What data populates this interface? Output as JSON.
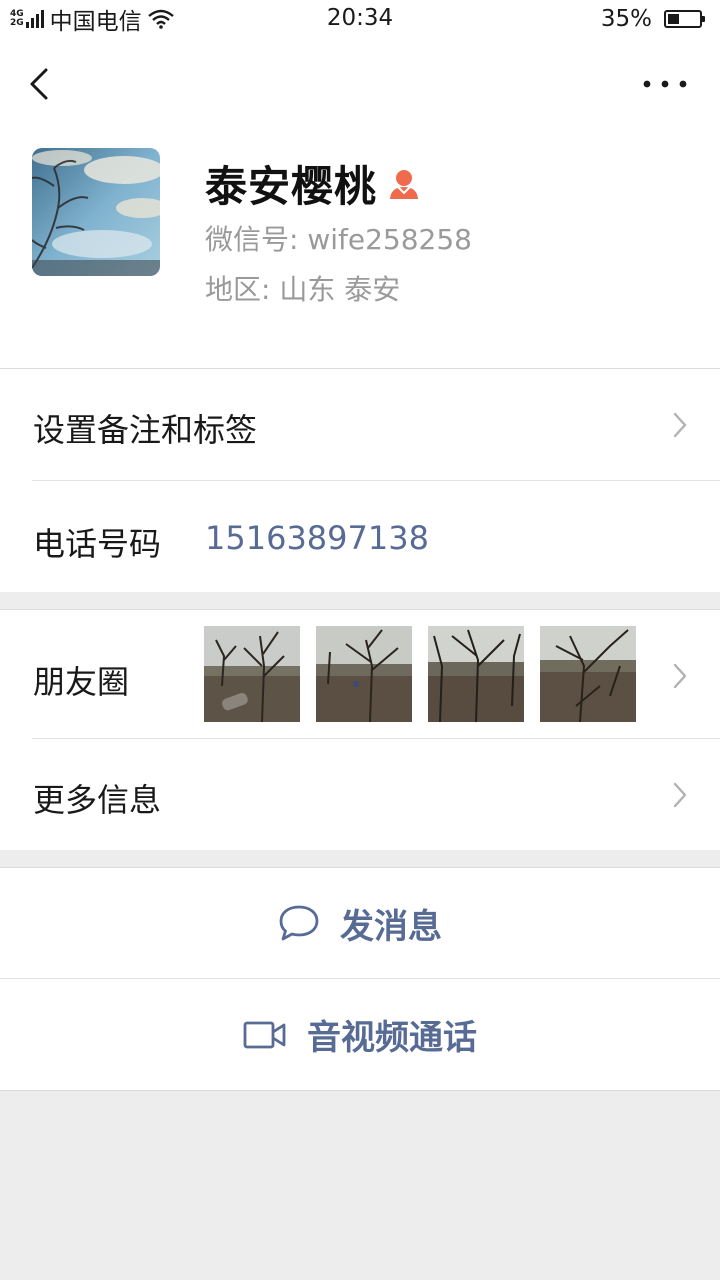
{
  "status_bar": {
    "network_top": "4G",
    "network_bottom": "2G",
    "carrier": "中国电信",
    "time": "20:34",
    "battery_text": "35%",
    "battery_level": 0.35
  },
  "profile": {
    "nickname": "泰安樱桃",
    "wechat_id": "微信号: wife258258",
    "region": "地区: 山东  泰安"
  },
  "cells": {
    "remark_label": "设置备注和标签",
    "phone_label": "电话号码",
    "phone_value": "15163897138",
    "moments_label": "朋友圈",
    "more_info_label": "更多信息"
  },
  "actions": {
    "message_label": "发消息",
    "call_label": "音视频通话"
  },
  "colors": {
    "link": "#576b95",
    "gender_female": "#f06a4d"
  }
}
